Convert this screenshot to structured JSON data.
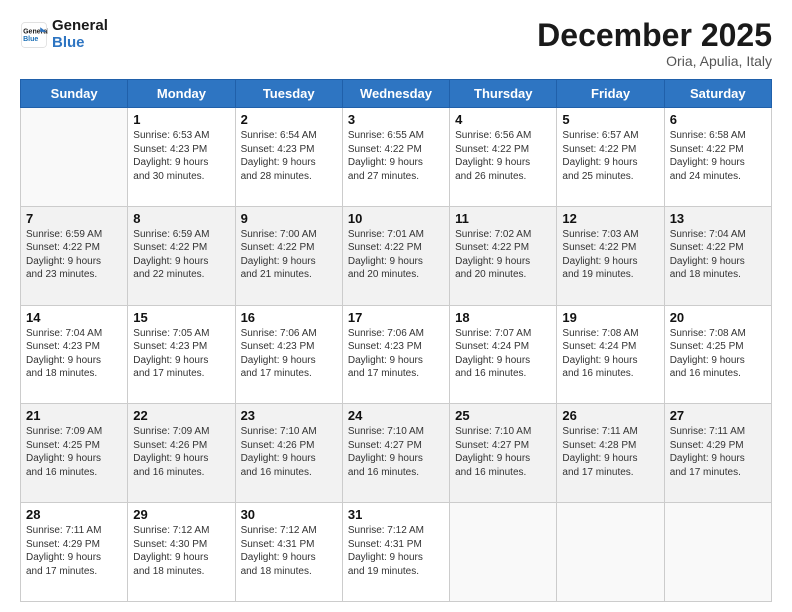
{
  "header": {
    "logo_line1": "General",
    "logo_line2": "Blue",
    "month": "December 2025",
    "location": "Oria, Apulia, Italy"
  },
  "days_of_week": [
    "Sunday",
    "Monday",
    "Tuesday",
    "Wednesday",
    "Thursday",
    "Friday",
    "Saturday"
  ],
  "weeks": [
    [
      {
        "day": null
      },
      {
        "day": 1,
        "sunrise": "6:53 AM",
        "sunset": "4:23 PM",
        "daylight": "9 hours and 30 minutes."
      },
      {
        "day": 2,
        "sunrise": "6:54 AM",
        "sunset": "4:23 PM",
        "daylight": "9 hours and 28 minutes."
      },
      {
        "day": 3,
        "sunrise": "6:55 AM",
        "sunset": "4:22 PM",
        "daylight": "9 hours and 27 minutes."
      },
      {
        "day": 4,
        "sunrise": "6:56 AM",
        "sunset": "4:22 PM",
        "daylight": "9 hours and 26 minutes."
      },
      {
        "day": 5,
        "sunrise": "6:57 AM",
        "sunset": "4:22 PM",
        "daylight": "9 hours and 25 minutes."
      },
      {
        "day": 6,
        "sunrise": "6:58 AM",
        "sunset": "4:22 PM",
        "daylight": "9 hours and 24 minutes."
      }
    ],
    [
      {
        "day": 7,
        "sunrise": "6:59 AM",
        "sunset": "4:22 PM",
        "daylight": "9 hours and 23 minutes."
      },
      {
        "day": 8,
        "sunrise": "6:59 AM",
        "sunset": "4:22 PM",
        "daylight": "9 hours and 22 minutes."
      },
      {
        "day": 9,
        "sunrise": "7:00 AM",
        "sunset": "4:22 PM",
        "daylight": "9 hours and 21 minutes."
      },
      {
        "day": 10,
        "sunrise": "7:01 AM",
        "sunset": "4:22 PM",
        "daylight": "9 hours and 20 minutes."
      },
      {
        "day": 11,
        "sunrise": "7:02 AM",
        "sunset": "4:22 PM",
        "daylight": "9 hours and 20 minutes."
      },
      {
        "day": 12,
        "sunrise": "7:03 AM",
        "sunset": "4:22 PM",
        "daylight": "9 hours and 19 minutes."
      },
      {
        "day": 13,
        "sunrise": "7:04 AM",
        "sunset": "4:22 PM",
        "daylight": "9 hours and 18 minutes."
      }
    ],
    [
      {
        "day": 14,
        "sunrise": "7:04 AM",
        "sunset": "4:23 PM",
        "daylight": "9 hours and 18 minutes."
      },
      {
        "day": 15,
        "sunrise": "7:05 AM",
        "sunset": "4:23 PM",
        "daylight": "9 hours and 17 minutes."
      },
      {
        "day": 16,
        "sunrise": "7:06 AM",
        "sunset": "4:23 PM",
        "daylight": "9 hours and 17 minutes."
      },
      {
        "day": 17,
        "sunrise": "7:06 AM",
        "sunset": "4:23 PM",
        "daylight": "9 hours and 17 minutes."
      },
      {
        "day": 18,
        "sunrise": "7:07 AM",
        "sunset": "4:24 PM",
        "daylight": "9 hours and 16 minutes."
      },
      {
        "day": 19,
        "sunrise": "7:08 AM",
        "sunset": "4:24 PM",
        "daylight": "9 hours and 16 minutes."
      },
      {
        "day": 20,
        "sunrise": "7:08 AM",
        "sunset": "4:25 PM",
        "daylight": "9 hours and 16 minutes."
      }
    ],
    [
      {
        "day": 21,
        "sunrise": "7:09 AM",
        "sunset": "4:25 PM",
        "daylight": "9 hours and 16 minutes."
      },
      {
        "day": 22,
        "sunrise": "7:09 AM",
        "sunset": "4:26 PM",
        "daylight": "9 hours and 16 minutes."
      },
      {
        "day": 23,
        "sunrise": "7:10 AM",
        "sunset": "4:26 PM",
        "daylight": "9 hours and 16 minutes."
      },
      {
        "day": 24,
        "sunrise": "7:10 AM",
        "sunset": "4:27 PM",
        "daylight": "9 hours and 16 minutes."
      },
      {
        "day": 25,
        "sunrise": "7:10 AM",
        "sunset": "4:27 PM",
        "daylight": "9 hours and 16 minutes."
      },
      {
        "day": 26,
        "sunrise": "7:11 AM",
        "sunset": "4:28 PM",
        "daylight": "9 hours and 17 minutes."
      },
      {
        "day": 27,
        "sunrise": "7:11 AM",
        "sunset": "4:29 PM",
        "daylight": "9 hours and 17 minutes."
      }
    ],
    [
      {
        "day": 28,
        "sunrise": "7:11 AM",
        "sunset": "4:29 PM",
        "daylight": "9 hours and 17 minutes."
      },
      {
        "day": 29,
        "sunrise": "7:12 AM",
        "sunset": "4:30 PM",
        "daylight": "9 hours and 18 minutes."
      },
      {
        "day": 30,
        "sunrise": "7:12 AM",
        "sunset": "4:31 PM",
        "daylight": "9 hours and 18 minutes."
      },
      {
        "day": 31,
        "sunrise": "7:12 AM",
        "sunset": "4:31 PM",
        "daylight": "9 hours and 19 minutes."
      },
      {
        "day": null
      },
      {
        "day": null
      },
      {
        "day": null
      }
    ]
  ],
  "labels": {
    "sunrise": "Sunrise:",
    "sunset": "Sunset:",
    "daylight": "Daylight:"
  }
}
